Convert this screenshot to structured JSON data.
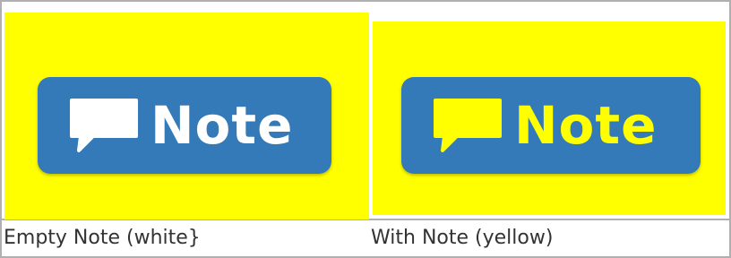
{
  "table": {
    "left": {
      "button_label": "Note",
      "icon": "speech-bubble-icon",
      "icon_color": "#ffffff",
      "text_color": "#ffffff",
      "caption": "Empty Note (white}"
    },
    "right": {
      "button_label": "Note",
      "icon": "speech-bubble-icon",
      "icon_color": "#ffff00",
      "text_color": "#ffff00",
      "caption": "With Note (yellow)"
    }
  },
  "colors": {
    "highlight_background": "#ffff00",
    "button_background": "#3479b8",
    "border": "#b0b0b0",
    "caption_text": "#333333"
  }
}
